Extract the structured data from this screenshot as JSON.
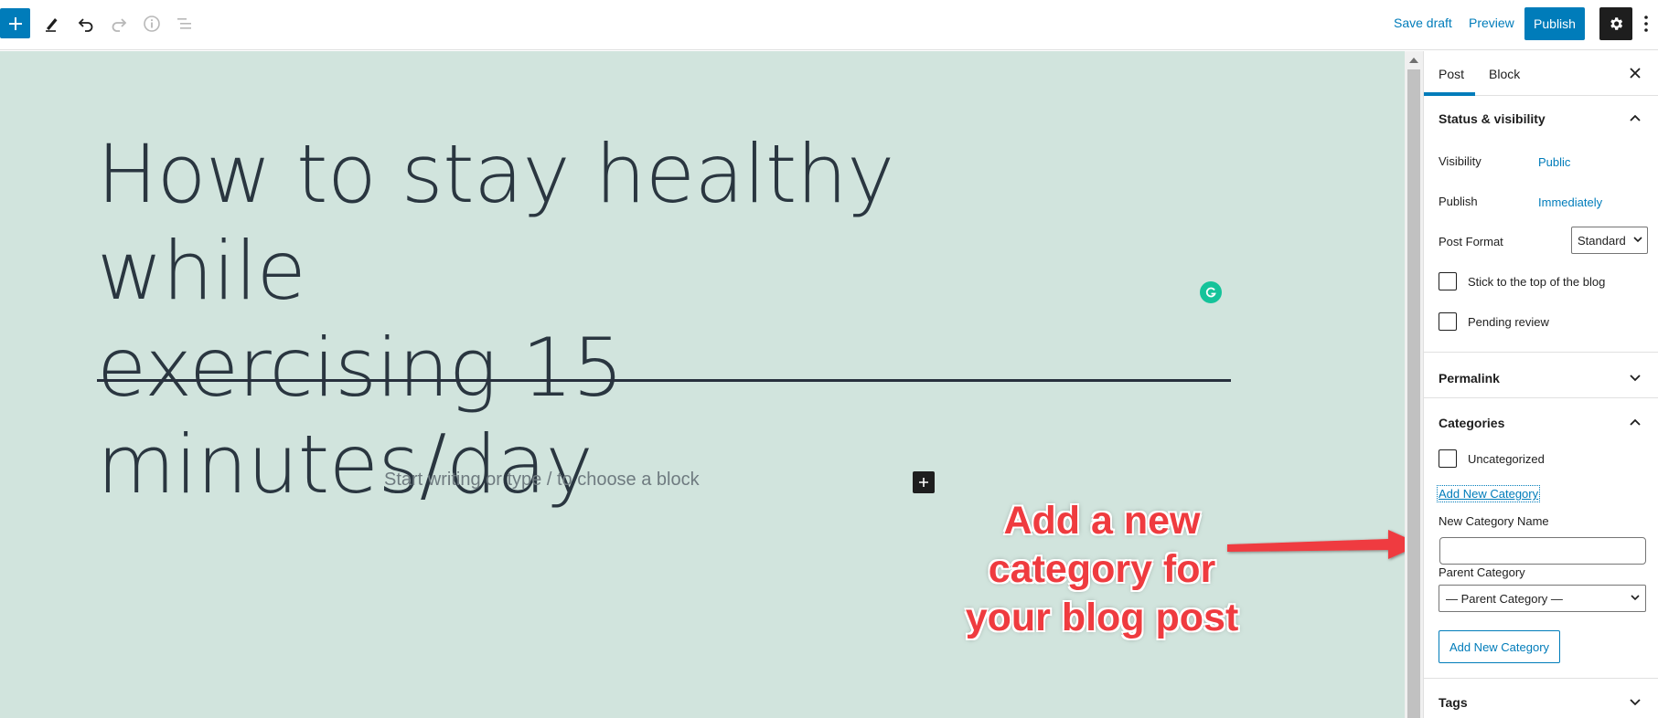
{
  "toolbar": {
    "save_draft": "Save draft",
    "preview": "Preview",
    "publish": "Publish"
  },
  "editor": {
    "title_line1": "How to stay healthy while",
    "title_line2": "exercising 15 minutes/day",
    "placeholder": "Start writing or type / to choose a block"
  },
  "annotation": {
    "line1": "Add a new",
    "line2": "category for",
    "line3": "your blog post",
    "color": "#ef3b3f"
  },
  "sidebar": {
    "tabs": [
      {
        "label": "Post"
      },
      {
        "label": "Block"
      }
    ],
    "status": {
      "title": "Status & visibility",
      "visibility_label": "Visibility",
      "visibility_value": "Public",
      "publish_label": "Publish",
      "publish_value": "Immediately",
      "format_label": "Post Format",
      "format_value": "Standard",
      "sticky_label": "Stick to the top of the blog",
      "pending_label": "Pending review"
    },
    "permalink": {
      "title": "Permalink"
    },
    "categories": {
      "title": "Categories",
      "items": [
        {
          "label": "Uncategorized"
        }
      ],
      "add_link": "Add New Category",
      "new_name_label": "New Category Name",
      "parent_label": "Parent Category",
      "parent_value": "— Parent Category —",
      "add_button": "Add New Category"
    },
    "tags": {
      "title": "Tags"
    }
  },
  "colors": {
    "accent": "#007cba",
    "canvas_bg": "#d1e4dd",
    "grammarly": "#15c39a"
  }
}
